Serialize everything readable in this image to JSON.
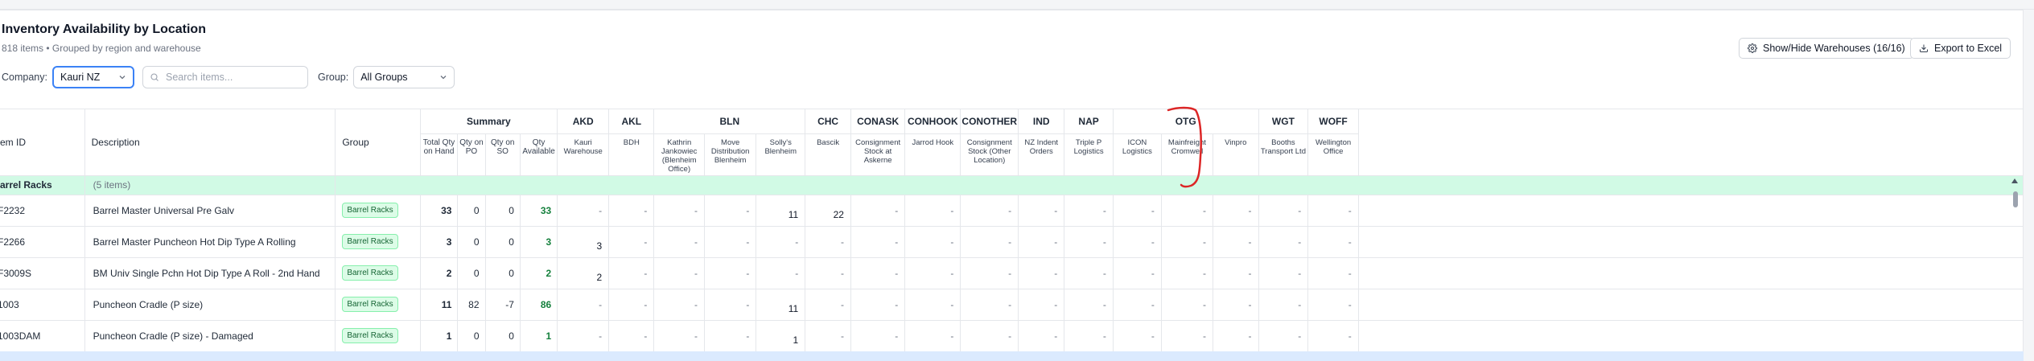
{
  "header": {
    "title": "Inventory Availability by Location",
    "subtitle": "818 items • Grouped by region and warehouse"
  },
  "toolbar": {
    "show_hide_label": "Show/Hide Warehouses (16/16)",
    "export_label": "Export to Excel"
  },
  "filters": {
    "company_label": "Company:",
    "company_value": "Kauri NZ",
    "search_placeholder": "Search items...",
    "group_label": "Group:",
    "group_value": "All Groups"
  },
  "grid": {
    "fixed_headers": {
      "item_id": "Item ID",
      "item_id_visible": "em ID",
      "description": "Description",
      "group": "Group"
    },
    "summary_header": "Summary",
    "summary_columns": [
      "Total Qty on Hand",
      "Qty on PO",
      "Qty on SO",
      "Qty Available"
    ],
    "regions": [
      {
        "code": "AKD",
        "warehouses": [
          "Kauri Warehouse"
        ]
      },
      {
        "code": "AKL",
        "warehouses": [
          "BDH"
        ]
      },
      {
        "code": "BLN",
        "warehouses": [
          "Kathrin Jankowiec (Blenheim Office)",
          "Move Distribution Blenheim",
          "Solly's Blenheim"
        ]
      },
      {
        "code": "CHC",
        "warehouses": [
          "Bascik"
        ]
      },
      {
        "code": "CONASK",
        "warehouses": [
          "Consignment Stock at Askerne"
        ]
      },
      {
        "code": "CONHOOK",
        "warehouses": [
          "Jarrod Hook"
        ]
      },
      {
        "code": "CONOTHER",
        "warehouses": [
          "Consignment Stock (Other Location)"
        ]
      },
      {
        "code": "IND",
        "warehouses": [
          "NZ Indent Orders"
        ]
      },
      {
        "code": "NAP",
        "warehouses": [
          "Triple P Logistics"
        ]
      },
      {
        "code": "OTG",
        "warehouses": [
          "ICON Logistics",
          "Mainfreight Cromwell",
          "Vinpro"
        ]
      },
      {
        "code": "WGT",
        "warehouses": [
          "Booths Transport Ltd"
        ]
      },
      {
        "code": "WOFF",
        "warehouses": [
          "Wellington Office"
        ]
      }
    ],
    "group_row": {
      "label": "Barrel Racks",
      "visible_label": "arrel Racks",
      "count": "(5 items)"
    },
    "rows": [
      {
        "id": "F2232",
        "desc": "Barrel Master Universal Pre Galv",
        "group": "Barrel Racks",
        "on_hand": "33",
        "po": "0",
        "so": "0",
        "avail": "33",
        "locs": [
          "-",
          "-",
          "-",
          "-",
          "11",
          "22",
          "-",
          "-",
          "-",
          "-",
          "-",
          "-",
          "-",
          "-",
          "-",
          "-"
        ]
      },
      {
        "id": "F2266",
        "desc": "Barrel Master Puncheon Hot Dip Type A Rolling",
        "group": "Barrel Racks",
        "on_hand": "3",
        "po": "0",
        "so": "0",
        "avail": "3",
        "locs": [
          "3",
          "-",
          "-",
          "-",
          "-",
          "-",
          "-",
          "-",
          "-",
          "-",
          "-",
          "-",
          "-",
          "-",
          "-",
          "-"
        ]
      },
      {
        "id": "F3009S",
        "desc": "BM Univ Single Pchn Hot Dip Type A Roll - 2nd Hand",
        "group": "Barrel Racks",
        "on_hand": "2",
        "po": "0",
        "so": "0",
        "avail": "2",
        "locs": [
          "2",
          "-",
          "-",
          "-",
          "-",
          "-",
          "-",
          "-",
          "-",
          "-",
          "-",
          "-",
          "-",
          "-",
          "-",
          "-"
        ]
      },
      {
        "id": "1003",
        "desc": "Puncheon Cradle (P size)",
        "group": "Barrel Racks",
        "on_hand": "11",
        "po": "82",
        "so": "-7",
        "avail": "86",
        "locs": [
          "-",
          "-",
          "-",
          "-",
          "11",
          "-",
          "-",
          "-",
          "-",
          "-",
          "-",
          "-",
          "-",
          "-",
          "-",
          "-"
        ]
      },
      {
        "id": "1003DAM",
        "desc": "Puncheon Cradle (P size) - Damaged",
        "group": "Barrel Racks",
        "on_hand": "1",
        "po": "0",
        "so": "0",
        "avail": "1",
        "locs": [
          "-",
          "-",
          "-",
          "-",
          "1",
          "-",
          "-",
          "-",
          "-",
          "-",
          "-",
          "-",
          "-",
          "-",
          "-",
          "-"
        ]
      }
    ]
  },
  "colors": {
    "accent": "#3b82f6",
    "group_row_bg": "#d1fae5",
    "available_green": "#15803d",
    "annotation_red": "#dc2626"
  }
}
